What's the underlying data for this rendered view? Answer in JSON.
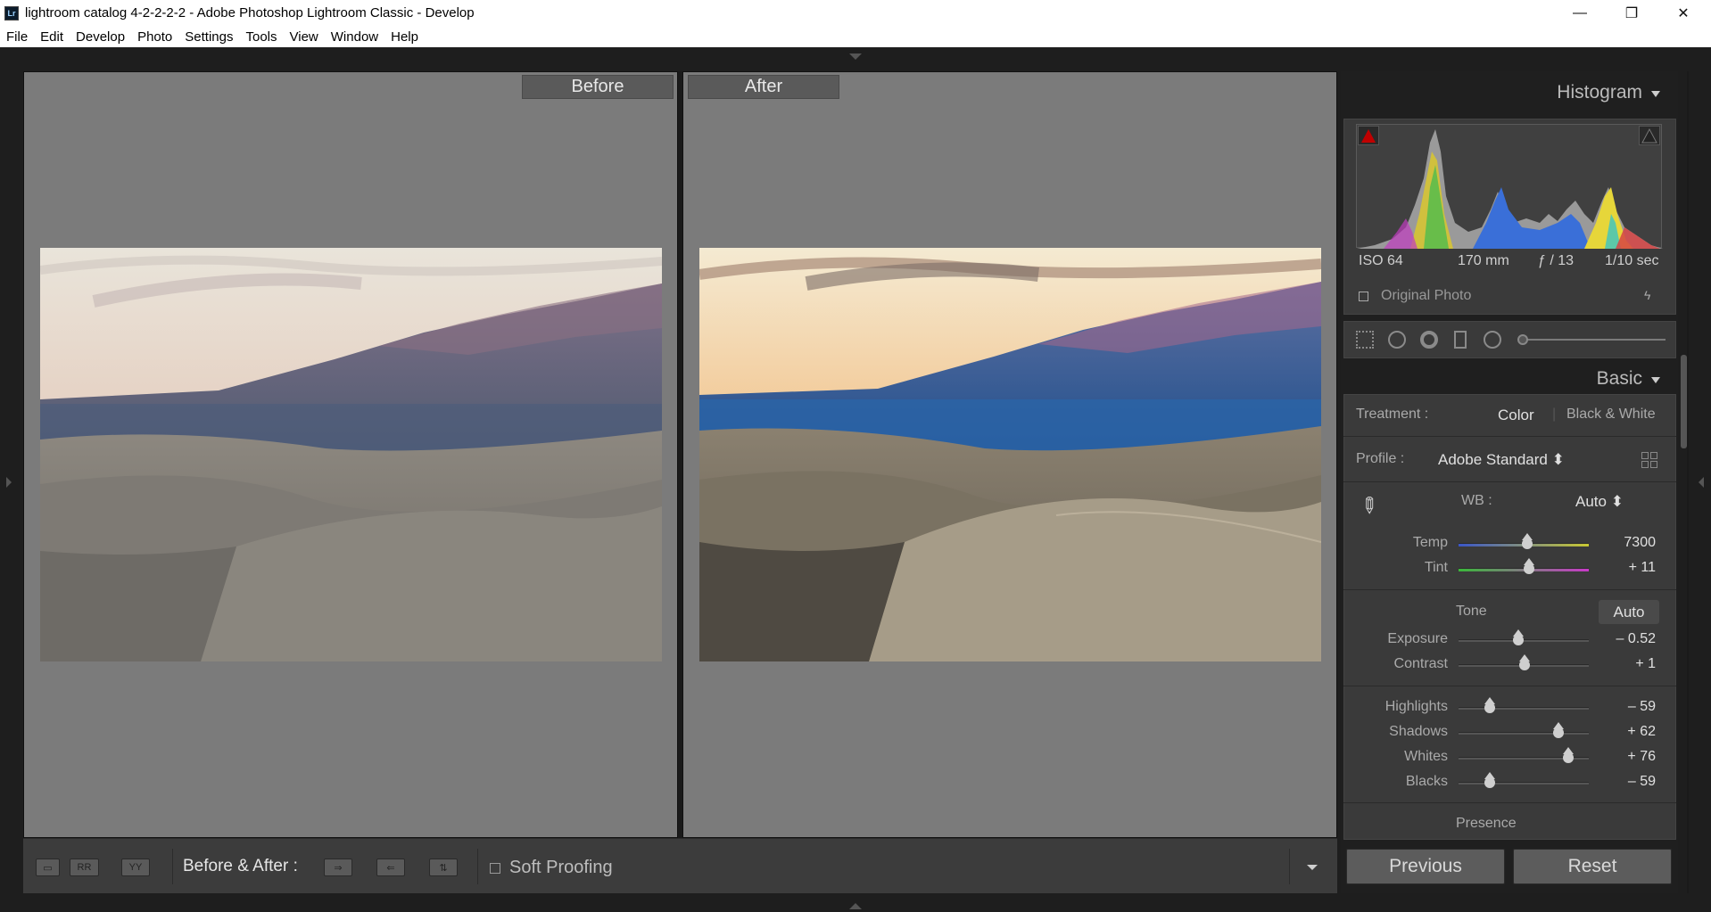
{
  "window": {
    "title": "lightroom catalog 4-2-2-2-2 - Adobe Photoshop Lightroom Classic - Develop",
    "logo": "Lr",
    "minimize_icon": "—",
    "restore_icon": "❐",
    "close_icon": "✕"
  },
  "menu": [
    "File",
    "Edit",
    "Develop",
    "Photo",
    "Settings",
    "Tools",
    "View",
    "Window",
    "Help"
  ],
  "view": {
    "before_label": "Before",
    "after_label": "After"
  },
  "toolbar": {
    "mode_label": "Before & After :",
    "soft_proofing_label": "Soft Proofing",
    "soft_proofing_checked": false
  },
  "histogram": {
    "header": "Histogram",
    "iso": "ISO 64",
    "focal": "170 mm",
    "aperture": "ƒ / 13",
    "shutter": "1/10 sec",
    "original_photo_label": "Original Photo"
  },
  "basic": {
    "header": "Basic",
    "treatment_label": "Treatment :",
    "treatment_color": "Color",
    "treatment_bw": "Black & White",
    "profile_label": "Profile :",
    "profile_value": "Adobe Standard ⬍",
    "wb_label": "WB :",
    "wb_value": "Auto ⬍",
    "tone_label": "Tone",
    "auto_label": "Auto",
    "presence_label": "Presence",
    "sliders": [
      {
        "label": "Temp",
        "value": "7300",
        "pos": 0.53
      },
      {
        "label": "Tint",
        "value": "+ 11",
        "pos": 0.54
      },
      {
        "label": "Exposure",
        "value": "– 0.52",
        "pos": 0.46
      },
      {
        "label": "Contrast",
        "value": "+ 1",
        "pos": 0.51
      },
      {
        "label": "Highlights",
        "value": "– 59",
        "pos": 0.24
      },
      {
        "label": "Shadows",
        "value": "+ 62",
        "pos": 0.77
      },
      {
        "label": "Whites",
        "value": "+ 76",
        "pos": 0.84
      },
      {
        "label": "Blacks",
        "value": "– 59",
        "pos": 0.24
      }
    ]
  },
  "footer": {
    "previous_label": "Previous",
    "reset_label": "Reset"
  },
  "colors": {
    "panel_bg": "#3a3a3a",
    "view_bg": "#7b7b7b",
    "accent_clip": "#c00000"
  }
}
